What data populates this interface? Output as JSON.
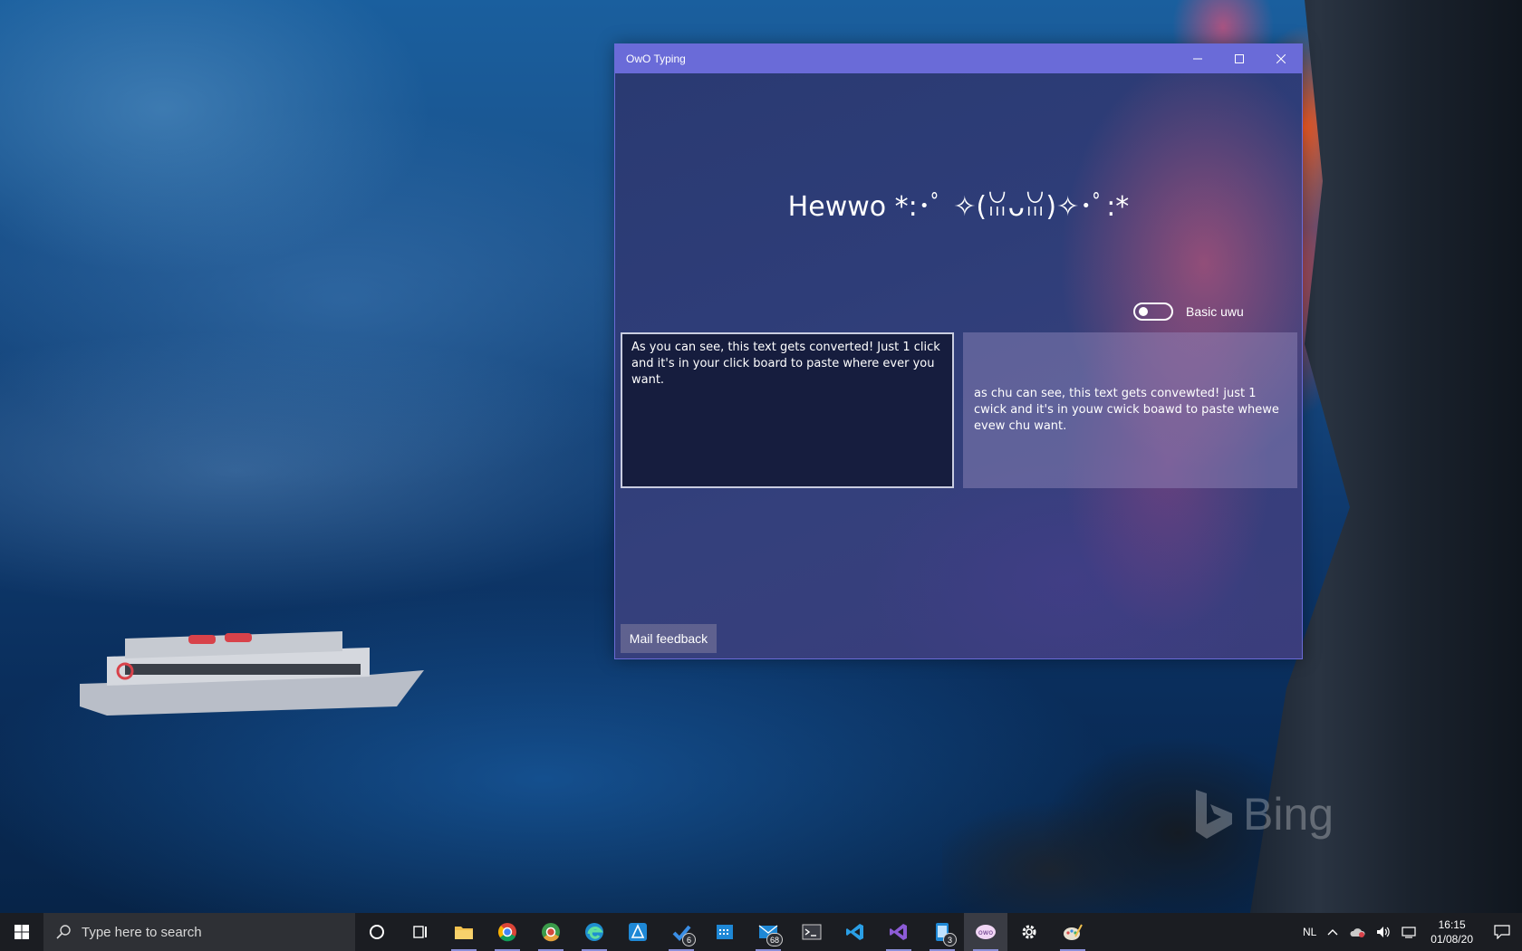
{
  "window": {
    "title": "OwO Typing",
    "heading": "Hewwo *:･ﾟ ✧(ꈍᴗꈍ)✧･ﾟ:*",
    "toggle_label": "Basic uwu",
    "toggle_on": false,
    "input_text": "As you can see, this text gets converted! Just 1 click and it's in your click board to paste where ever you want.",
    "output_text": "as chu can see, this text gets convewted! just 1 cwick and it's in youw cwick boawd to paste whewe evew chu want.",
    "feedback_button": "Mail feedback"
  },
  "desktop": {
    "watermark": "Bing"
  },
  "taskbar": {
    "search_placeholder": "Type here to search",
    "apps": [
      {
        "name": "cortana",
        "icon": "circle-icon"
      },
      {
        "name": "task-view",
        "icon": "task-view-icon"
      },
      {
        "name": "file-explorer",
        "icon": "folder-icon"
      },
      {
        "name": "chrome",
        "icon": "chrome-icon"
      },
      {
        "name": "chrome-canary",
        "icon": "chrome-icon"
      },
      {
        "name": "edge",
        "icon": "edge-icon"
      },
      {
        "name": "affinity-designer",
        "icon": "affinity-icon"
      },
      {
        "name": "todo",
        "icon": "check-icon",
        "badge": "6"
      },
      {
        "name": "calendar",
        "icon": "calendar-icon"
      },
      {
        "name": "mail",
        "icon": "mail-icon",
        "badge": "68"
      },
      {
        "name": "terminal",
        "icon": "terminal-icon"
      },
      {
        "name": "vscode",
        "icon": "vscode-icon"
      },
      {
        "name": "visual-studio",
        "icon": "visual-studio-icon"
      },
      {
        "name": "phone",
        "icon": "phone-icon",
        "badge": "3"
      },
      {
        "name": "owo-typing",
        "icon": "owo-icon"
      },
      {
        "name": "settings",
        "icon": "gear-icon"
      },
      {
        "name": "paint",
        "icon": "paint-icon"
      }
    ],
    "tray": {
      "language": "NL",
      "time": "16:15",
      "date": "01/08/20"
    }
  },
  "colors": {
    "titlebar": "#6a6bd8",
    "taskbar": "#1b1d22",
    "accent": "#8a8fd8"
  }
}
